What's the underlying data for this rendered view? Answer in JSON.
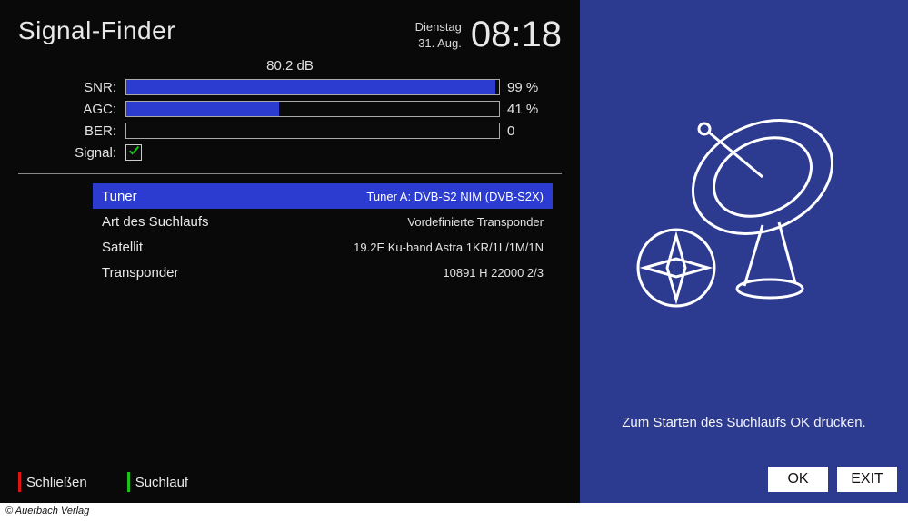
{
  "header": {
    "title": "Signal-Finder",
    "day": "Dienstag",
    "date": "31. Aug.",
    "time": "08:18"
  },
  "signal": {
    "db_value": "80.2 dB",
    "meters": [
      {
        "label": "SNR:",
        "percent": 99,
        "value_text": "99 %"
      },
      {
        "label": "AGC:",
        "percent": 41,
        "value_text": "41 %"
      },
      {
        "label": "BER:",
        "percent": 0,
        "value_text": "0"
      }
    ],
    "signal_label": "Signal:",
    "signal_ok": true
  },
  "settings": [
    {
      "label": "Tuner",
      "value": "Tuner A: DVB-S2 NIM (DVB-S2X)",
      "selected": true
    },
    {
      "label": "Art des Suchlaufs",
      "value": "Vordefinierte Transponder",
      "selected": false
    },
    {
      "label": "Satellit",
      "value": "19.2E Ku-band Astra 1KR/1L/1M/1N",
      "selected": false
    },
    {
      "label": "Transponder",
      "value": "10891 H 22000 2/3",
      "selected": false
    }
  ],
  "hints": {
    "red": "Schließen",
    "green": "Suchlauf"
  },
  "right_panel": {
    "instruction": "Zum Starten des Suchlaufs OK drücken.",
    "ok_label": "OK",
    "exit_label": "EXIT"
  },
  "copyright": "© Auerbach Verlag"
}
